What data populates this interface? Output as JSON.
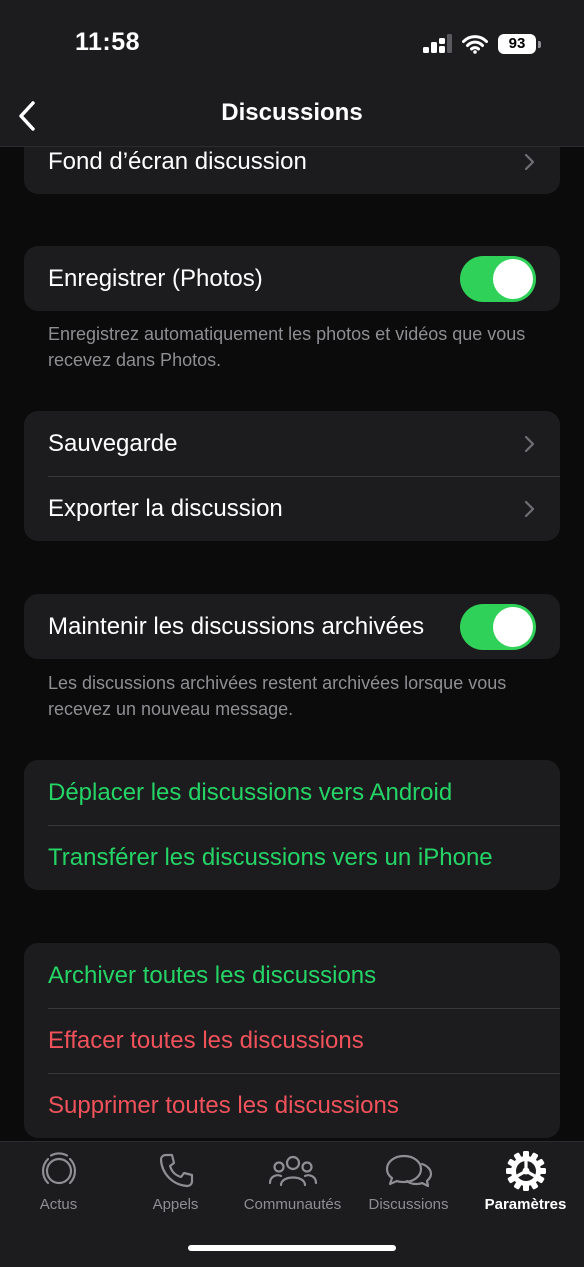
{
  "status_bar": {
    "time": "11:58",
    "battery": "93"
  },
  "nav": {
    "title": "Discussions",
    "back_icon": "chevron-left-icon"
  },
  "groups": {
    "wallpaper": {
      "label": "Fond d’écran discussion"
    },
    "save_photos": {
      "label": "Enregistrer (Photos)",
      "toggle_on": true,
      "footnote": "Enregistrez automatiquement les photos et vidéos que vous recevez dans Photos."
    },
    "backup": {
      "items": [
        "Sauvegarde",
        "Exporter la discussion"
      ]
    },
    "archived": {
      "label": "Maintenir les discussions archivées",
      "toggle_on": true,
      "footnote": "Les discussions archivées restent archivées lorsque vous recevez un nouveau message."
    },
    "transfer": {
      "items": [
        "Déplacer les discussions vers Android",
        "Transférer les discussions vers un iPhone"
      ]
    },
    "danger": {
      "items": [
        "Archiver toutes les discussions",
        "Effacer toutes les discussions",
        "Supprimer toutes les discussions"
      ]
    }
  },
  "colors": {
    "accent_green": "#25d366",
    "destructive_red": "#f0525b",
    "toggle_green": "#30d158"
  },
  "tabs": [
    {
      "label": "Actus",
      "icon": "updates-icon",
      "active": false
    },
    {
      "label": "Appels",
      "icon": "phone-icon",
      "active": false
    },
    {
      "label": "Communautés",
      "icon": "communities-icon",
      "active": false
    },
    {
      "label": "Discussions",
      "icon": "chats-icon",
      "active": false
    },
    {
      "label": "Paramètres",
      "icon": "settings-gear-icon",
      "active": true
    }
  ]
}
